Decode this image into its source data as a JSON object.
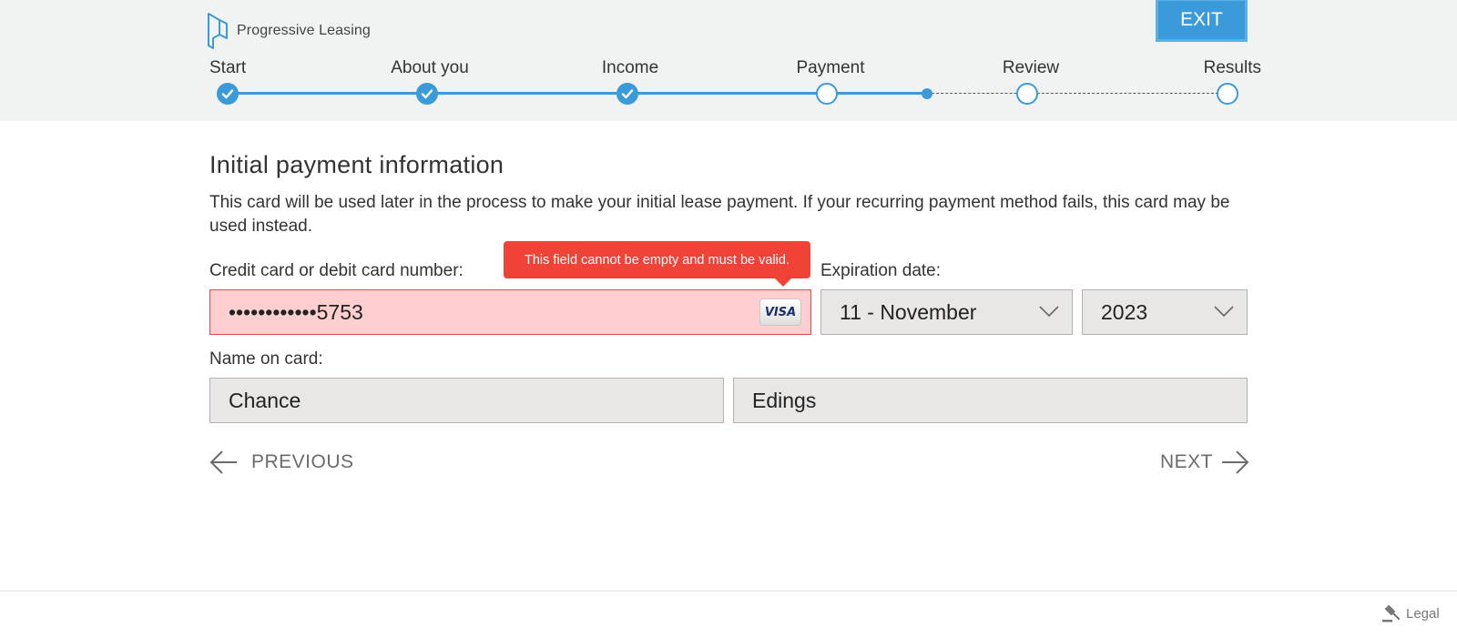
{
  "brand": {
    "name": "Progressive Leasing",
    "accent": "#3b9ad9",
    "error": "#ef4338"
  },
  "header": {
    "exit_label": "EXIT"
  },
  "steps": [
    {
      "label": "Start",
      "status": "done"
    },
    {
      "label": "About you",
      "status": "done"
    },
    {
      "label": "Income",
      "status": "done"
    },
    {
      "label": "Payment",
      "status": "current"
    },
    {
      "label": "Review",
      "status": "pending"
    },
    {
      "label": "Results",
      "status": "pending"
    }
  ],
  "form": {
    "title": "Initial payment information",
    "description": "This card will be used later in the process to make your initial lease payment. If your recurring payment method fails, this card may be used instead.",
    "card_label": "Credit card or debit card number:",
    "card_value": "••••••••••••5753",
    "card_brand": "VISA",
    "card_error": "This field cannot be empty and must be valid.",
    "expiration_label": "Expiration date:",
    "exp_month": "11 - November",
    "exp_year": "2023",
    "name_label": "Name on card:",
    "first_name": "Chance",
    "last_name": "Edings"
  },
  "nav": {
    "previous_label": "PREVIOUS",
    "next_label": "NEXT"
  },
  "footer": {
    "legal_label": "Legal"
  }
}
